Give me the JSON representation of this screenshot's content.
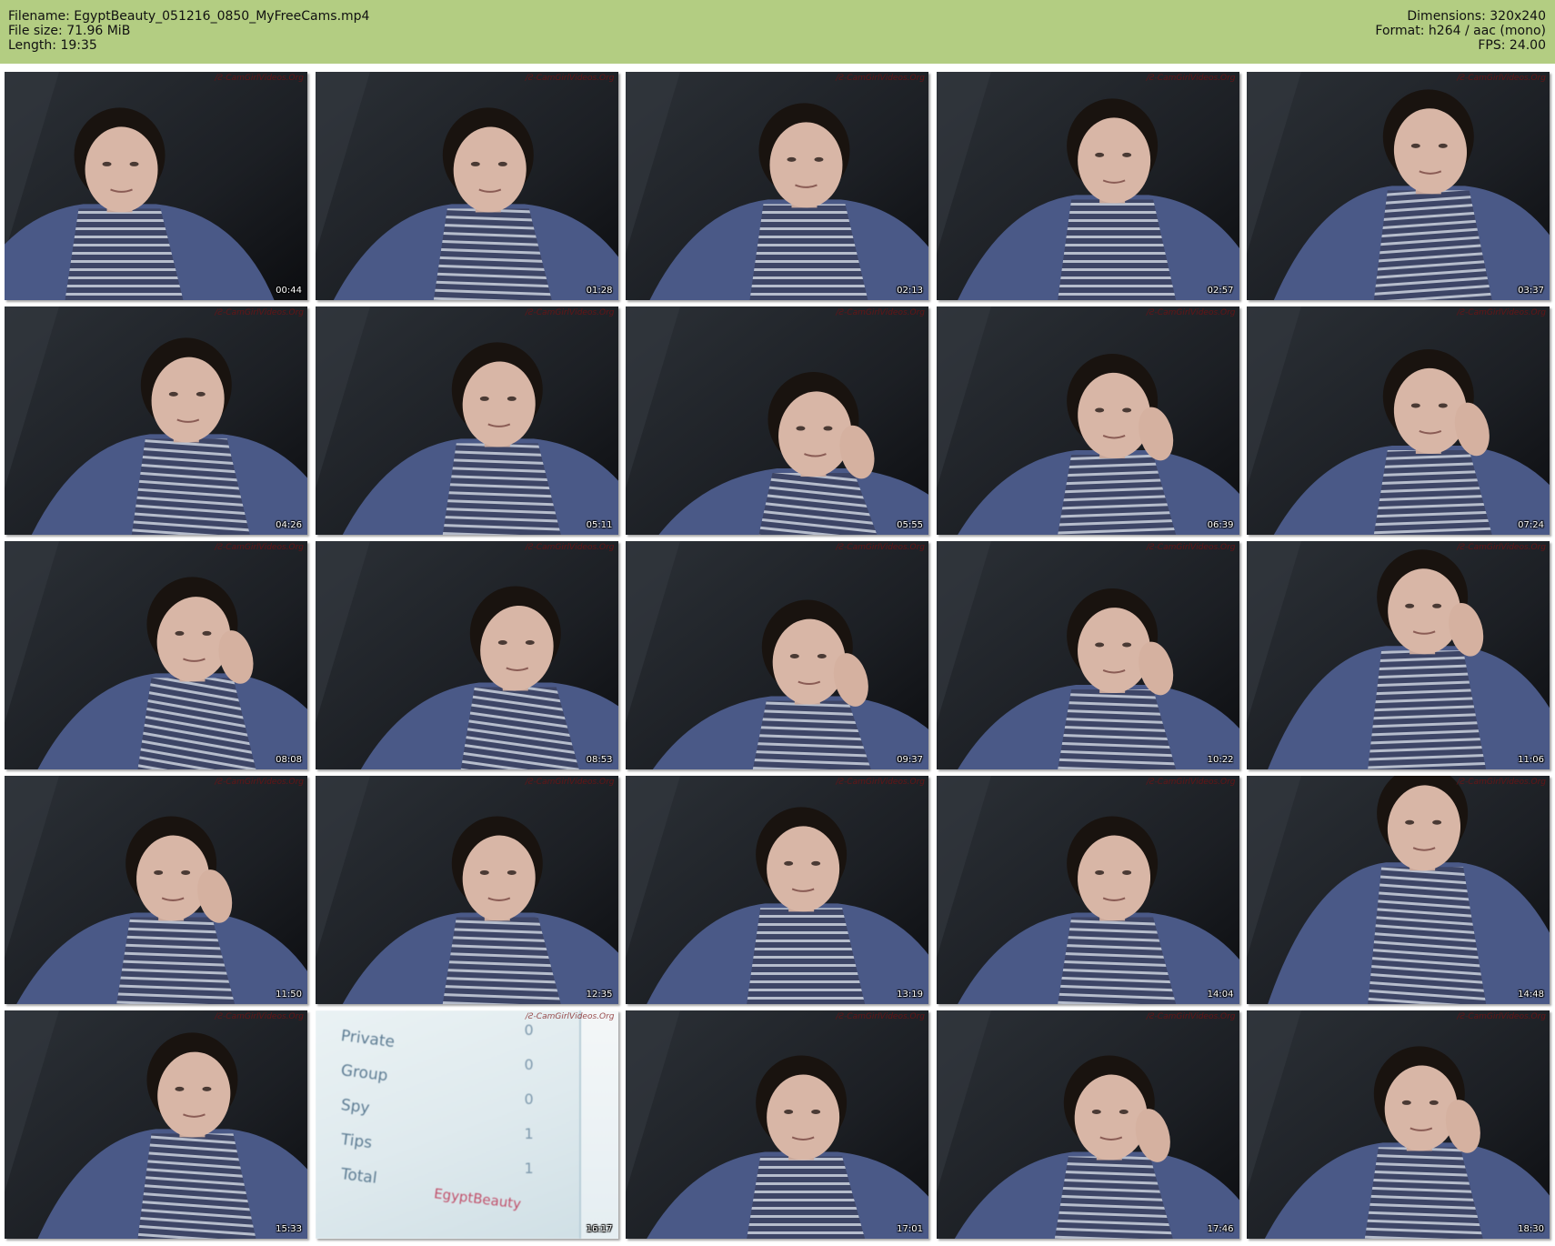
{
  "header": {
    "filename": "Filename: EgyptBeauty_051216_0850_MyFreeCams.mp4",
    "filesize": "File size: 71.96 MiB",
    "length": "Length: 19:35",
    "dimensions": "Dimensions: 320x240",
    "format": "Format: h264 / aac (mono)",
    "fps": "FPS: 24.00"
  },
  "watermark": "/Ƨ-CamGirlVideos.Org",
  "thumbnails": [
    {
      "time": "00:44"
    },
    {
      "time": "01:28"
    },
    {
      "time": "02:13"
    },
    {
      "time": "02:57"
    },
    {
      "time": "03:37"
    },
    {
      "time": "04:26"
    },
    {
      "time": "05:11"
    },
    {
      "time": "05:55"
    },
    {
      "time": "06:39"
    },
    {
      "time": "07:24"
    },
    {
      "time": "08:08"
    },
    {
      "time": "08:53"
    },
    {
      "time": "09:37"
    },
    {
      "time": "10:22"
    },
    {
      "time": "11:06"
    },
    {
      "time": "11:50"
    },
    {
      "time": "12:35"
    },
    {
      "time": "13:19"
    },
    {
      "time": "14:04"
    },
    {
      "time": "14:48"
    },
    {
      "time": "15:33"
    },
    {
      "time": "16:17"
    },
    {
      "time": "17:01"
    },
    {
      "time": "17:46"
    },
    {
      "time": "18:30"
    }
  ],
  "screen_frame": {
    "rows": [
      {
        "label": "Private",
        "count": "0"
      },
      {
        "label": "Group",
        "count": "0"
      },
      {
        "label": "Spy",
        "count": "0"
      },
      {
        "label": "Tips",
        "count": "1"
      },
      {
        "label": "Total",
        "count": "1"
      }
    ],
    "username": "EgyptBeauty"
  }
}
